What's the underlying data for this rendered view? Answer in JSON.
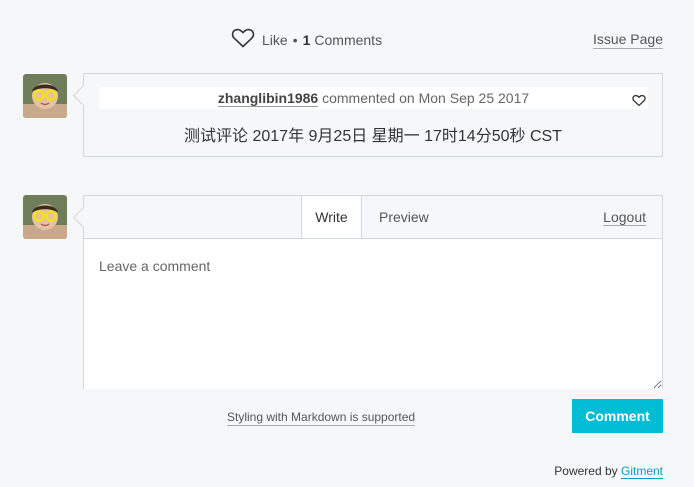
{
  "header": {
    "like_label": "Like",
    "separator": "•",
    "comment_count": "1",
    "comments_label": "Comments",
    "issue_page_label": "Issue Page"
  },
  "comment": {
    "author": "zhanglibin1986",
    "action": "commented on",
    "date": "Mon Sep 25 2017",
    "body": "测试评论 2017年 9月25日 星期一 17时14分50秒 CST"
  },
  "editor": {
    "tab_write": "Write",
    "tab_preview": "Preview",
    "logout_label": "Logout",
    "placeholder": "Leave a comment",
    "markdown_tip": "Styling with Markdown is supported",
    "submit_label": "Comment"
  },
  "footer": {
    "powered_by": "Powered by",
    "link_label": "Gitment"
  },
  "colors": {
    "accent": "#00bcd4",
    "background": "#f6f7f9",
    "border": "#cfd8dc"
  }
}
